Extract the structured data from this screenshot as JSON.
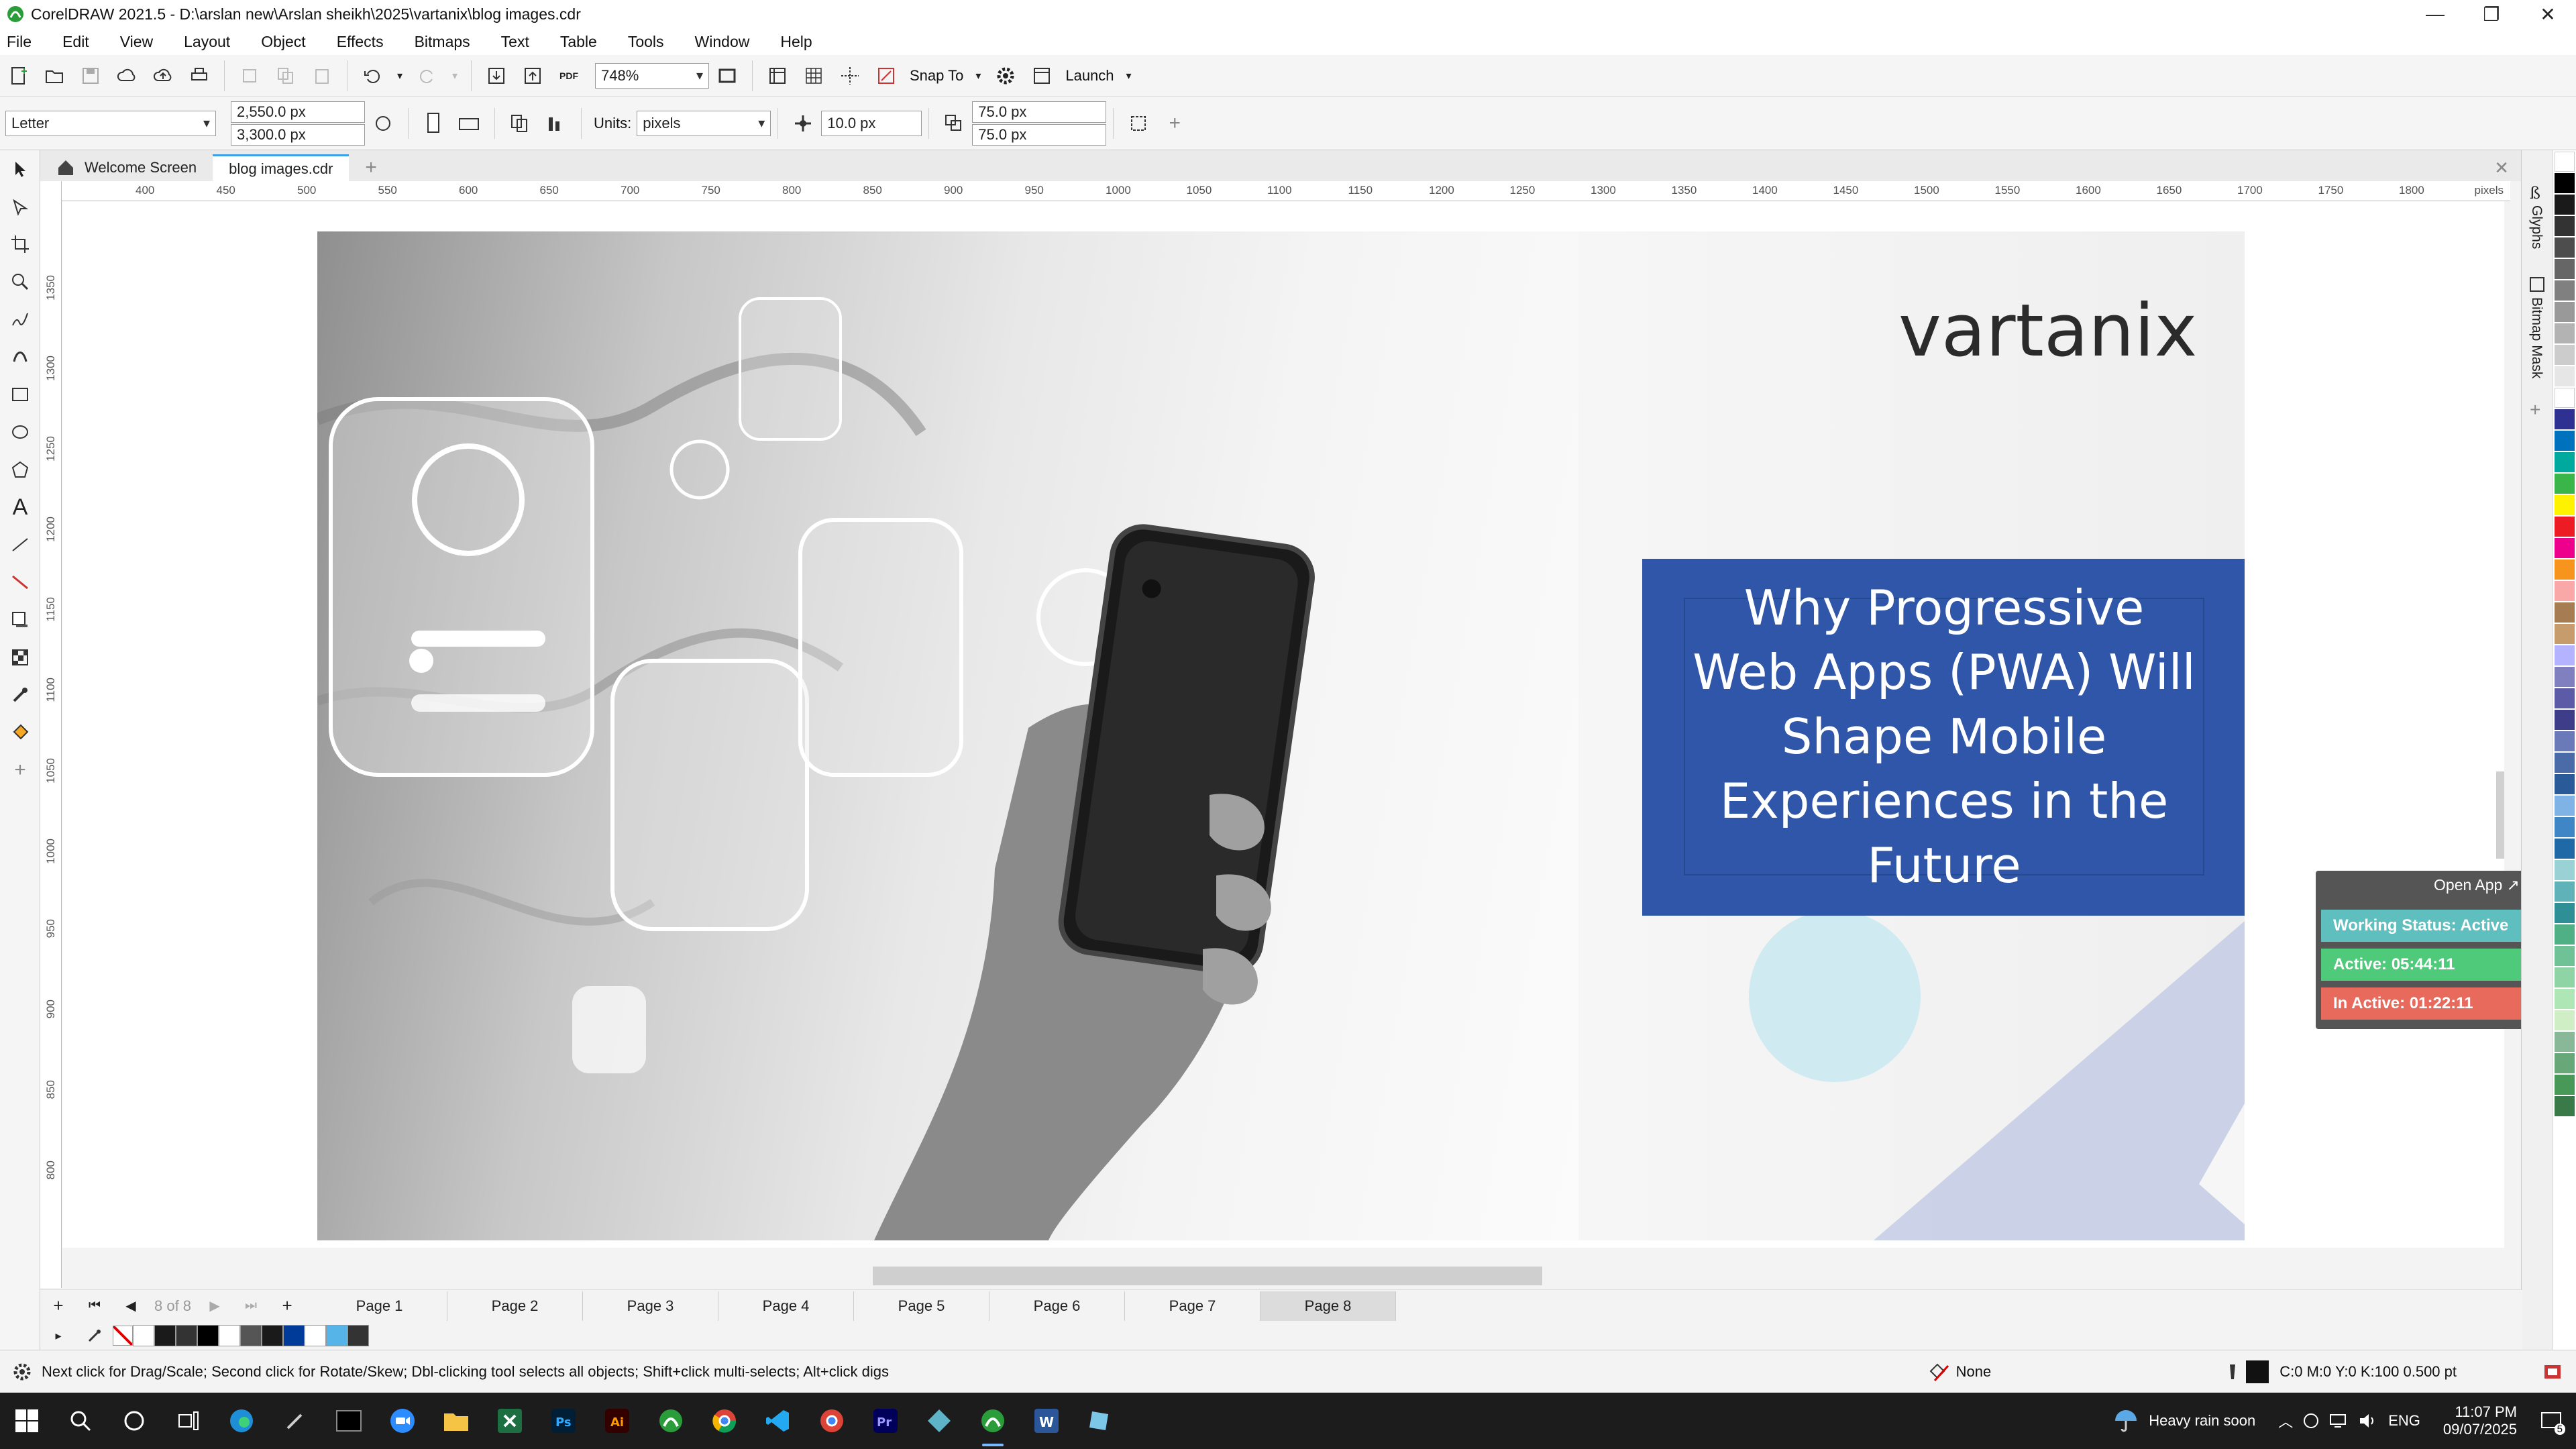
{
  "window": {
    "title": "CorelDRAW 2021.5 - D:\\arslan new\\Arslan sheikh\\2025\\vartanix\\blog images.cdr"
  },
  "menu": [
    "File",
    "Edit",
    "View",
    "Layout",
    "Object",
    "Effects",
    "Bitmaps",
    "Text",
    "Table",
    "Tools",
    "Window",
    "Help"
  ],
  "toolbar": {
    "zoom": "748%",
    "snap_to": "Snap To",
    "launch": "Launch",
    "pdf_label": "PDF"
  },
  "property_bar": {
    "page_size": "Letter",
    "width": "2,550.0 px",
    "height": "3,300.0 px",
    "units_label": "Units:",
    "units": "pixels",
    "nudge": "10.0 px",
    "dup_x": "75.0 px",
    "dup_y": "75.0 px"
  },
  "doc_tabs": [
    "Welcome Screen",
    "blog images.cdr"
  ],
  "ruler": {
    "h_ticks": [
      "400",
      "450",
      "500",
      "550",
      "600",
      "650",
      "700",
      "750",
      "800",
      "850",
      "900",
      "950",
      "1000",
      "1050",
      "1100",
      "1150",
      "1200",
      "1250",
      "1300",
      "1350",
      "1400",
      "1450",
      "1500",
      "1550",
      "1600",
      "1650",
      "1700",
      "1750",
      "1800"
    ],
    "v_ticks": [
      "1350",
      "1300",
      "1250",
      "1200",
      "1150",
      "1100",
      "1050",
      "1000",
      "950",
      "900",
      "850",
      "800"
    ],
    "unit": "pixels"
  },
  "artwork": {
    "logo_text": "vartanix",
    "headline": "Why Progressive Web Apps (PWA) Will Shape Mobile Experiences in the Future"
  },
  "dockers": {
    "glyphs": "Glyphs",
    "bitmap_mask": "Bitmap Mask"
  },
  "status_widget": {
    "open_app": "Open App ↗",
    "working_status": "Working Status: Active",
    "active": "Active: 05:44:11",
    "inactive": "In Active: 01:22:11",
    "colors": {
      "working": "#5fbfbf",
      "active": "#4fc97a",
      "inactive": "#e86a5c"
    }
  },
  "pages": {
    "counter": "8 of 8",
    "tabs": [
      "Page 1",
      "Page 2",
      "Page 3",
      "Page 4",
      "Page 5",
      "Page 6",
      "Page 7",
      "Page 8"
    ],
    "active_index": 7
  },
  "status_bar": {
    "hint": "Next click for Drag/Scale; Second click for Rotate/Skew; Dbl-clicking tool selects all objects; Shift+click multi-selects; Alt+click digs",
    "fill": "None",
    "outline": "C:0 M:0 Y:0 K:100  0.500 pt"
  },
  "taskbar": {
    "weather": "Heavy rain soon",
    "lang": "ENG",
    "time": "11:07 PM",
    "date": "09/07/2025",
    "notifications": "5"
  },
  "palette_colors": [
    "#ffffff",
    "#000000",
    "#1a1a1a",
    "#333333",
    "#4d4d4d",
    "#666666",
    "#808080",
    "#999999",
    "#b3b3b3",
    "#cccccc",
    "#e6e6e6",
    "#ffffff",
    "#2e3192",
    "#0071bc",
    "#00a99d",
    "#39b54a",
    "#fff200",
    "#ed1c24",
    "#ec008c",
    "#f7941d",
    "#f9a7a7",
    "#a67c52",
    "#c69c6d",
    "#b3b3ff",
    "#8080c0",
    "#5b5ba8",
    "#3d3d8a",
    "#6a7ab8",
    "#4a6aa8",
    "#2a5a98",
    "#7fb2e5",
    "#3f86c6",
    "#1f6aa6",
    "#9ad1d4",
    "#5fb3b8",
    "#2f8f96",
    "#4fb085",
    "#6fc295",
    "#8fd4a5",
    "#afe6b5",
    "#cfeec5",
    "#88b898",
    "#68a878",
    "#489858",
    "#3a7a48"
  ],
  "doc_palette": [
    "#ffffff",
    "#1a1a1a",
    "#333333",
    "#000000",
    "#ffffff",
    "#555555",
    "#1a1a1a",
    "#003b9a",
    "#ffffff",
    "#56b4e9",
    "#333333"
  ]
}
